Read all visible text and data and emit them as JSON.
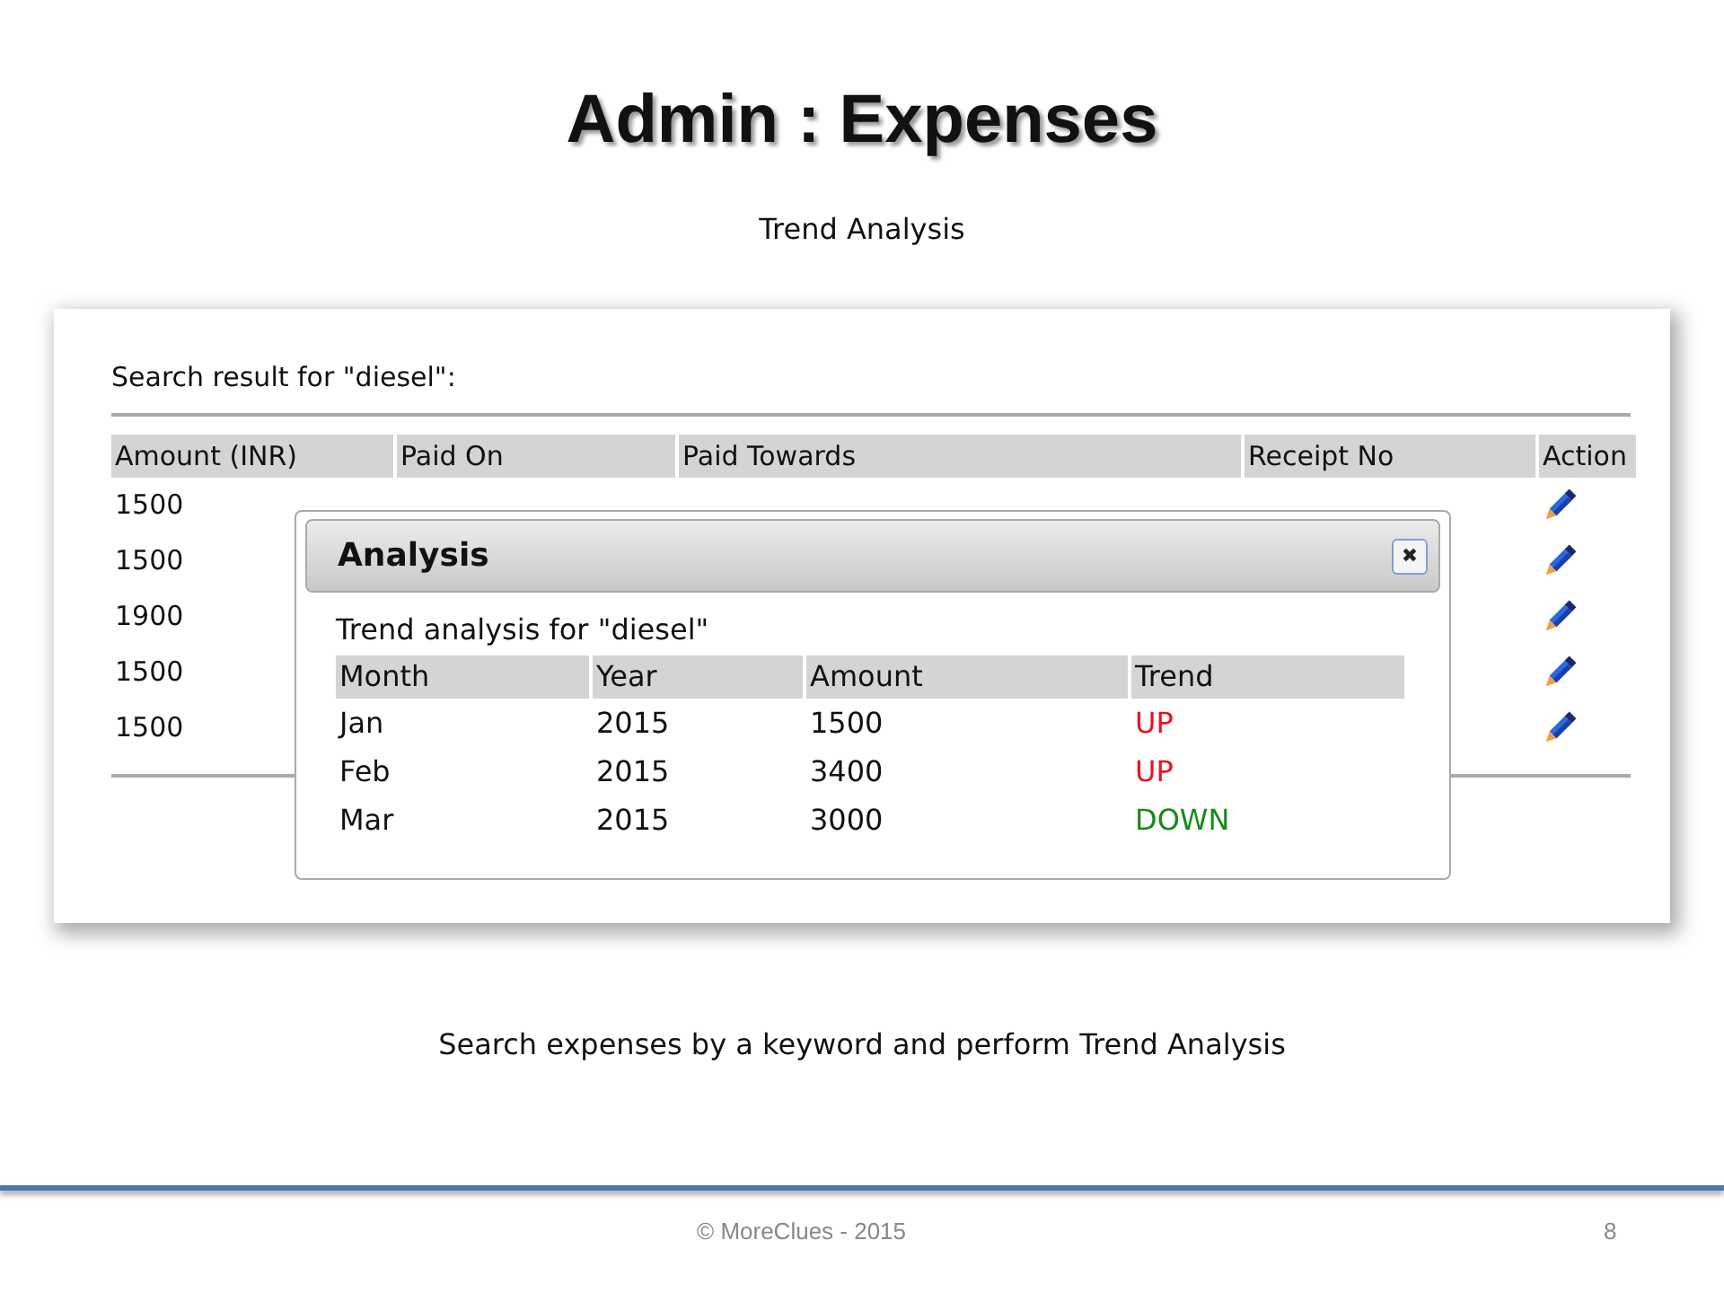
{
  "slide": {
    "title": "Admin : Expenses",
    "subtitle": "Trend Analysis",
    "caption": "Search expenses by a keyword and perform Trend Analysis",
    "footer": "© MoreClues - 2015",
    "page_number": "8"
  },
  "search": {
    "heading": "Search result for \"diesel\":",
    "columns": [
      "Amount (INR)",
      "Paid On",
      "Paid Towards",
      "Receipt No",
      "Action"
    ],
    "rows": [
      {
        "amount": "1500"
      },
      {
        "amount": "1500"
      },
      {
        "amount": "1900"
      },
      {
        "amount": "1500"
      },
      {
        "amount": "1500"
      }
    ]
  },
  "dialog": {
    "title": "Analysis",
    "close": "✖",
    "heading": "Trend analysis for \"diesel\"",
    "columns": [
      "Month",
      "Year",
      "Amount",
      "Trend"
    ],
    "rows": [
      {
        "month": "Jan",
        "year": "2015",
        "amount": "1500",
        "trend": "UP",
        "color": "#e8141c"
      },
      {
        "month": "Feb",
        "year": "2015",
        "amount": "3400",
        "trend": "UP",
        "color": "#e8141c"
      },
      {
        "month": "Mar",
        "year": "2015",
        "amount": "3000",
        "trend": "DOWN",
        "color": "#1a8a1a"
      }
    ]
  }
}
